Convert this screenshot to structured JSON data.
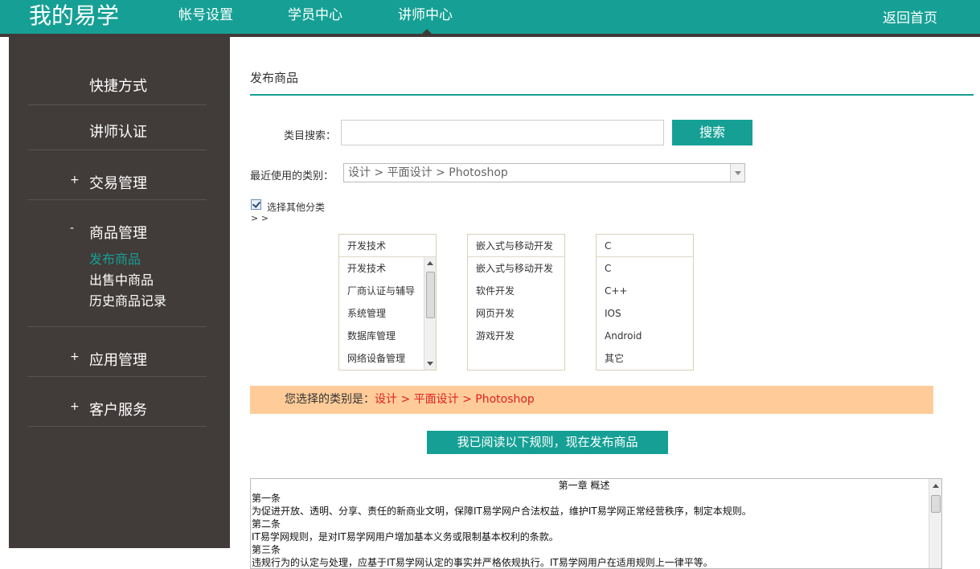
{
  "header": {
    "logo": "我的易学",
    "nav": [
      "帐号设置",
      "学员中心",
      "讲师中心"
    ],
    "home": "返回首页"
  },
  "sidebar": {
    "items": [
      {
        "label": "快捷方式",
        "mark": ""
      },
      {
        "label": "讲师认证",
        "mark": ""
      },
      {
        "label": "交易管理",
        "mark": "+"
      },
      {
        "label": "商品管理",
        "mark": "-"
      },
      {
        "label": "应用管理",
        "mark": "+"
      },
      {
        "label": "客户服务",
        "mark": "+"
      }
    ],
    "sub_items": [
      "发布商品",
      "出售中商品",
      "历史商品记录"
    ]
  },
  "main": {
    "title": "发布商品",
    "search_label": "类目搜索：",
    "search_value": "",
    "search_button": "搜索",
    "recent_label": "最近使用的类别：",
    "recent_value": "设计 > 平面设计 > Photoshop",
    "other_category_label": "选择其他分类",
    "breadcrumb_arrows": "> >",
    "columns": [
      {
        "header": "开发技术",
        "options": [
          "开发技术",
          "厂商认证与辅导",
          "系统管理",
          "数据库管理",
          "网络设备管理"
        ]
      },
      {
        "header": "嵌入式与移动开发",
        "options": [
          "嵌入式与移动开发",
          "软件开发",
          "网页开发",
          "游戏开发"
        ]
      },
      {
        "header": "C",
        "options": [
          "C",
          "C++",
          "IOS",
          "Android",
          "其它"
        ]
      }
    ],
    "selected_label": "您选择的类别是：",
    "selected_value": "设计 > 平面设计 > Photoshop",
    "agree_button": "我已阅读以下规则，现在发布商品",
    "rules": {
      "chapter": "第一章 概述",
      "lines": [
        "第一条",
        "为促进开放、透明、分享、责任的新商业文明，保障IT易学网户合法权益，维护IT易学网正常经营秩序，制定本规则。",
        "第二条",
        "IT易学网规则，是对IT易学网用户增加基本义务或限制基本权利的条款。",
        "第三条",
        "违规行为的认定与处理，应基于IT易学网认定的事实并严格依规执行。IT易学网用户在适用规则上一律平等。"
      ]
    }
  },
  "colors": {
    "accent": "#16a095",
    "sidebar": "#413b39",
    "selected_bar": "#ffcc99",
    "selected_text": "#e02020"
  }
}
